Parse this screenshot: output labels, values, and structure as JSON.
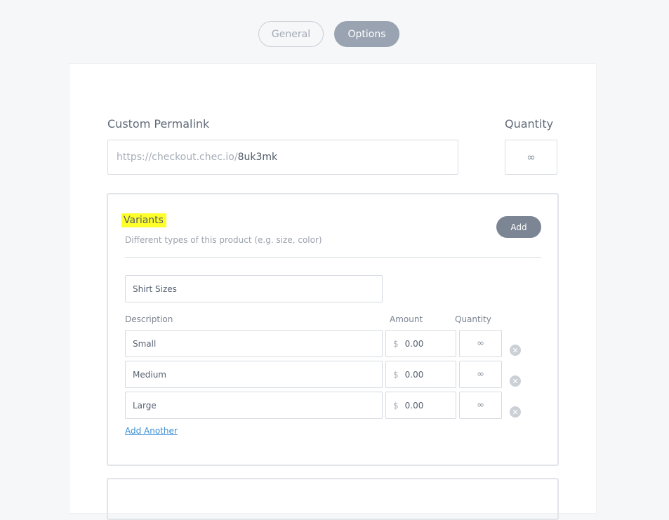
{
  "tabs": [
    {
      "label": "General",
      "active": false
    },
    {
      "label": "Options",
      "active": true
    }
  ],
  "permalink": {
    "label": "Custom Permalink",
    "prefix": "https://checkout.chec.io/",
    "value": "8uk3mk"
  },
  "quantity": {
    "label": "Quantity",
    "value": "∞"
  },
  "variants": {
    "title": "Variants",
    "description": "Different types of this product (e.g. size, color)",
    "add_label": "Add",
    "group_name": "Shirt Sizes",
    "columns": {
      "description": "Description",
      "amount": "Amount",
      "quantity": "Quantity"
    },
    "currency_symbol": "$",
    "rows": [
      {
        "description": "Small",
        "amount": "0.00",
        "quantity": "∞"
      },
      {
        "description": "Medium",
        "amount": "0.00",
        "quantity": "∞"
      },
      {
        "description": "Large",
        "amount": "0.00",
        "quantity": "∞"
      }
    ],
    "add_another_label": "Add Another",
    "remove_icon": "close-circle-icon"
  },
  "colors": {
    "active_tab": "#99a3b1",
    "highlight": "#ffff2a",
    "add_button": "#7b8594",
    "link": "#3a8fd6"
  }
}
